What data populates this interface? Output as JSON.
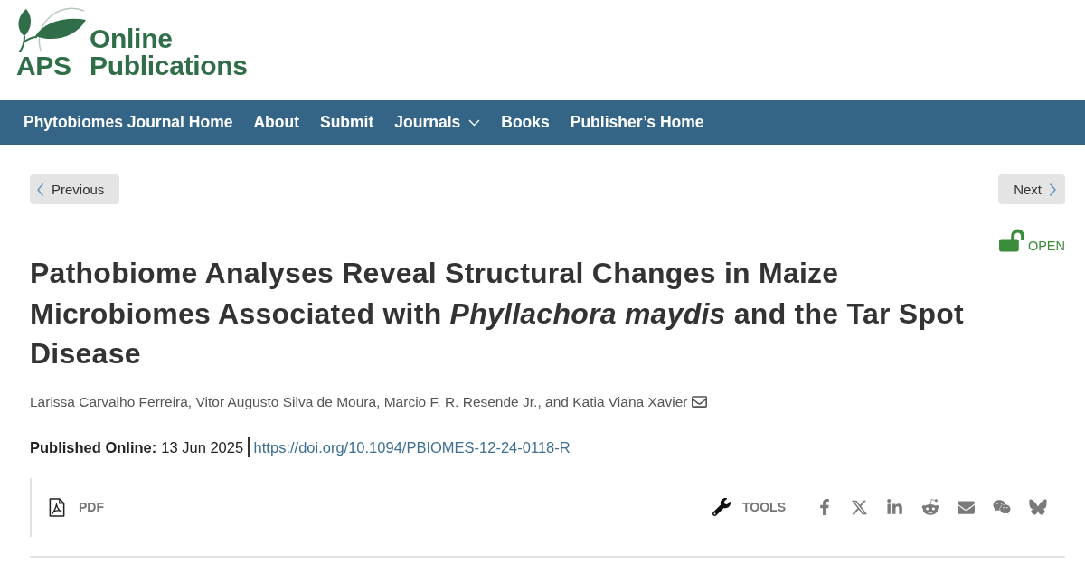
{
  "logo": {
    "line_1": "Online",
    "line_2_left": "APS",
    "line_2_right": "Publications"
  },
  "nav": {
    "items": [
      {
        "label": "Phytobiomes Journal Home",
        "kind": "link"
      },
      {
        "label": "About",
        "kind": "link"
      },
      {
        "label": "Submit",
        "kind": "link"
      },
      {
        "label": "Journals",
        "kind": "dropdown"
      },
      {
        "label": "Books",
        "kind": "link"
      },
      {
        "label": "Publisher’s Home",
        "kind": "link"
      }
    ]
  },
  "pager": {
    "previous": "Previous",
    "next": "Next"
  },
  "access": {
    "label": "OPEN",
    "open": true
  },
  "article": {
    "title": "Pathobiome Analyses Reveal Structural Changes in Maize Microbiomes Associated with *Phyllachora maydis* and the Tar Spot Disease",
    "authors": "Larissa Carvalho Ferreira, Vitor Augusto Silva de Moura, Marcio F. R. Resende Jr., and Katia Viana Xavier",
    "published_label": "Published Online:",
    "published_date": "13 Jun 2025",
    "doi": "https://doi.org/10.1094/PBIOMES-12-24-0118-R"
  },
  "toolbar": {
    "pdf": "PDF",
    "tools": "TOOLS"
  }
}
